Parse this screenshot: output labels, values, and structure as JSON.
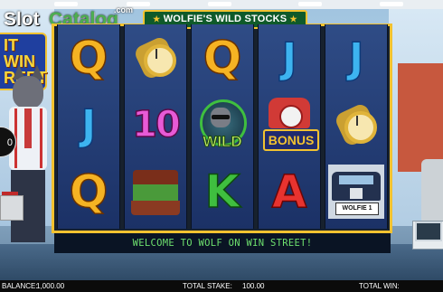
{
  "watermark": {
    "slot": "Slot",
    "catalog": "Catalog",
    "com": ".com"
  },
  "game_sign": [
    "IT",
    "WIN",
    "REET"
  ],
  "info_circle": "0",
  "banner": {
    "star_left": "★",
    "title": "WOLFIE'S WILD STOCKS",
    "star_right": "★"
  },
  "reels": [
    [
      "Q",
      "J",
      "Q"
    ],
    [
      "watch",
      "10",
      "briefcase"
    ],
    [
      "Q",
      "WILD",
      "K"
    ],
    [
      "J",
      "BONUS",
      "A"
    ],
    [
      "J",
      "watch",
      "car"
    ]
  ],
  "symbols": {
    "wild_label": "WILD",
    "bonus_label": "BONUS",
    "car_plate": "WOLFIE 1"
  },
  "message": "WELCOME TO WOLF ON WIN STREET!",
  "footer": {
    "balance_label": "BALANCE:",
    "balance_value": "1,000.00",
    "stake_label": "TOTAL STAKE:",
    "stake_value": "100.00",
    "win_label": "TOTAL WIN:",
    "win_value": ""
  },
  "colors": {
    "frame_gold": "#f2c230",
    "reel_blue": "#2f4c86",
    "message_green": "#6ee06e"
  }
}
